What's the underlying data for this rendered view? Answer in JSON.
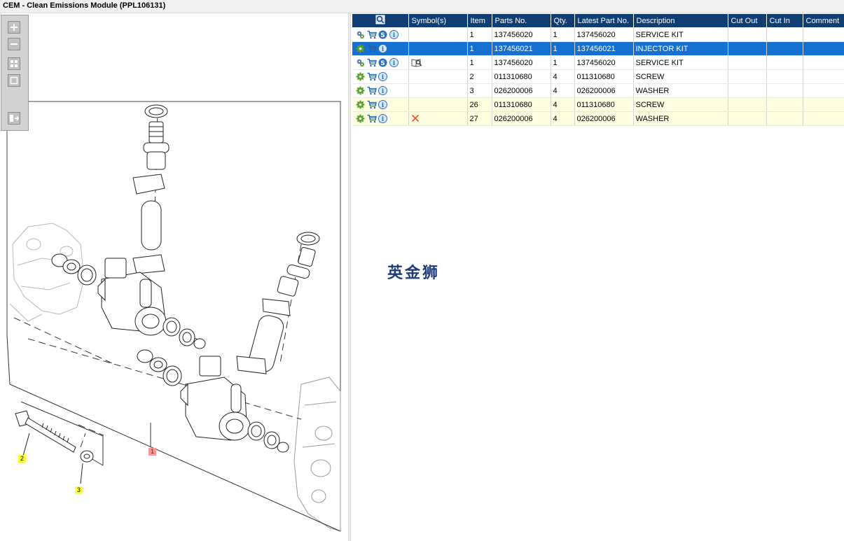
{
  "window": {
    "title": "CEM - Clean Emissions Module (PPL106131)"
  },
  "zoom_toolbar": {
    "buttons": [
      {
        "name": "zoom-in",
        "glyph": "+"
      },
      {
        "name": "zoom-out",
        "glyph": "−"
      },
      {
        "name": "fit-all",
        "glyph": "grid"
      },
      {
        "name": "fit-window",
        "glyph": "square"
      },
      {
        "name": "split-view",
        "glyph": "split"
      }
    ]
  },
  "drawing": {
    "callouts": [
      {
        "label": "1",
        "style": "red"
      },
      {
        "label": "2",
        "style": "yellow"
      },
      {
        "label": "3",
        "style": "yellow"
      }
    ]
  },
  "table": {
    "columns": [
      "",
      "Symbol(s)",
      "Item",
      "Parts No.",
      "Qty.",
      "Latest Part No.",
      "Description",
      "Cut Out",
      "Cut In",
      "Comment"
    ],
    "rows": [
      {
        "icons": [
          "settings-icon",
          "cart-icon",
          "s-icon",
          "info-icon"
        ],
        "symbol": "",
        "item": "1",
        "part_no": "137456020",
        "qty": "1",
        "latest": "137456020",
        "description": "SERVICE KIT",
        "cut_out": "",
        "cut_in": "",
        "comment": "",
        "state": "normal"
      },
      {
        "icons": [
          "gear-icon",
          "cart-icon",
          "info-icon"
        ],
        "symbol": "",
        "item": "1",
        "part_no": "137456021",
        "qty": "1",
        "latest": "137456021",
        "description": "INJECTOR KIT",
        "cut_out": "",
        "cut_in": "",
        "comment": "",
        "state": "selected"
      },
      {
        "icons": [
          "settings-icon",
          "cart-icon",
          "s-icon",
          "info-icon"
        ],
        "symbol": "book-search-icon",
        "item": "1",
        "part_no": "137456020",
        "qty": "1",
        "latest": "137456020",
        "description": "SERVICE KIT",
        "cut_out": "",
        "cut_in": "",
        "comment": "",
        "state": "normal"
      },
      {
        "icons": [
          "gear-icon",
          "cart-icon",
          "info-icon"
        ],
        "symbol": "",
        "item": "2",
        "part_no": "011310680",
        "qty": "4",
        "latest": "011310680",
        "description": "SCREW",
        "cut_out": "",
        "cut_in": "",
        "comment": "",
        "state": "normal"
      },
      {
        "icons": [
          "gear-icon",
          "cart-icon",
          "info-icon"
        ],
        "symbol": "",
        "item": "3",
        "part_no": "026200006",
        "qty": "4",
        "latest": "026200006",
        "description": "WASHER",
        "cut_out": "",
        "cut_in": "",
        "comment": "",
        "state": "normal"
      },
      {
        "icons": [
          "gear-icon",
          "cart-icon",
          "info-icon"
        ],
        "symbol": "",
        "item": "26",
        "part_no": "011310680",
        "qty": "4",
        "latest": "011310680",
        "description": "SCREW",
        "cut_out": "",
        "cut_in": "",
        "comment": "",
        "state": "yellow"
      },
      {
        "icons": [
          "gear-icon",
          "cart-icon",
          "info-icon"
        ],
        "symbol": "cross-icon",
        "item": "27",
        "part_no": "026200006",
        "qty": "4",
        "latest": "026200006",
        "description": "WASHER",
        "cut_out": "",
        "cut_in": "",
        "comment": "",
        "state": "yellow"
      }
    ]
  },
  "watermark": "英金狮",
  "colors": {
    "header_bg": "#103e74",
    "selected_bg": "#1570d2",
    "highlight_row": "#fffde0",
    "callout_yellow": "#ffff33",
    "callout_red": "#f29a9a"
  }
}
